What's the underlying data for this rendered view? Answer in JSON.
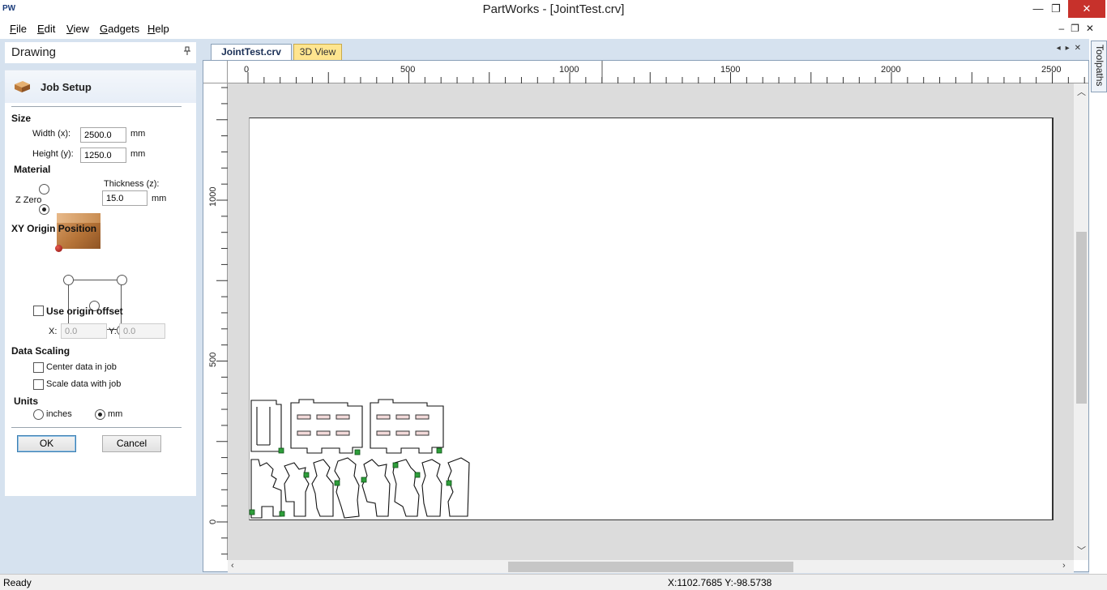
{
  "window": {
    "app_icon": "PW",
    "title": "PartWorks - [JointTest.crv]",
    "controls": {
      "minimize": "—",
      "restore": "❐",
      "close": "✕"
    }
  },
  "menu": {
    "items": [
      {
        "label": "File",
        "accel": "F",
        "rest": "ile"
      },
      {
        "label": "Edit",
        "accel": "E",
        "rest": "dit"
      },
      {
        "label": "View",
        "accel": "V",
        "rest": "iew"
      },
      {
        "label": "Gadgets",
        "accel": "G",
        "rest": "adgets"
      },
      {
        "label": "Help",
        "accel": "H",
        "rest": "elp"
      }
    ],
    "mdi_controls": "–❐✕"
  },
  "panel": {
    "title": "Drawing",
    "pin_icon": "pin-icon",
    "job_title": "Job Setup",
    "size": {
      "heading": "Size",
      "width_label": "Width (x):",
      "width_value": "2500.0",
      "width_unit": "mm",
      "height_label": "Height (y):",
      "height_value": "1250.0",
      "height_unit": "mm"
    },
    "material": {
      "heading": "Material",
      "thickness_label": "Thickness (z):",
      "thickness_value": "15.0",
      "thickness_unit": "mm",
      "zzero_label": "Z Zero",
      "zzero_selected": "bottom"
    },
    "origin": {
      "heading": "XY Origin Position",
      "selected": "bottom-left",
      "use_offset_label": "Use origin offset",
      "x_label": "X:",
      "x_value": "0.0",
      "y_label": "Y:",
      "y_value": "0.0"
    },
    "scaling": {
      "heading": "Data Scaling",
      "center_label": "Center data in job",
      "scale_label": "Scale data with job"
    },
    "units": {
      "heading": "Units",
      "inches_label": "inches",
      "mm_label": "mm",
      "selected": "mm"
    },
    "buttons": {
      "ok": "OK",
      "cancel": "Cancel"
    }
  },
  "tabs": [
    {
      "label": "JointTest.crv",
      "active": true
    },
    {
      "label": "3D View",
      "active": false
    }
  ],
  "tab_nav": "◂▸✕",
  "rulers": {
    "top_labels": [
      "0",
      "500",
      "1000",
      "1500",
      "2000",
      "2500"
    ],
    "left_labels": [
      "1000",
      "500",
      "0"
    ]
  },
  "side_tab": {
    "label": "Toolpaths"
  },
  "status": {
    "text": "Ready",
    "coords": "X:1102.7685 Y:-98.5738"
  },
  "colors": {
    "panel_bg": "#d6e2ef",
    "active_tab_text": "#1a2f55",
    "view_tab_bg": "#ffe58f",
    "node_green": "#2e9e3a",
    "close_red": "#c7312b"
  }
}
